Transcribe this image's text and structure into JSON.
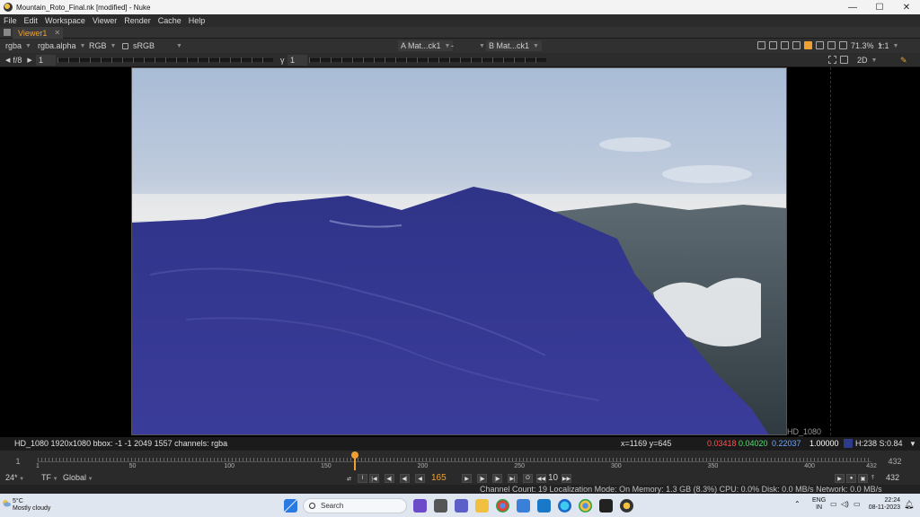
{
  "window": {
    "title": "Mountain_Roto_Final.nk [modified] - Nuke",
    "controls": [
      "—",
      "☐",
      "✕"
    ]
  },
  "menu": [
    "File",
    "Edit",
    "Workspace",
    "Viewer",
    "Render",
    "Cache",
    "Help"
  ],
  "tab": {
    "label": "Viewer1",
    "close": "✕"
  },
  "viewer_controls": {
    "channels": "rgba",
    "alpha": "rgba.alpha",
    "display": "RGB",
    "colorspace": "sRGB",
    "input_a": "A  Mat...ck1",
    "input_a_op": "-",
    "input_b": "B  Mat...ck1",
    "zoom": "71.3%",
    "proxy": "1:1",
    "fstop": "f/8",
    "gain_val": "1",
    "gamma_label": "γ",
    "gamma_val": "1",
    "view_mode": "2D"
  },
  "viewer": {
    "format_label": "HD_1080"
  },
  "info": {
    "format": "HD_1080 1920x1080  bbox: -1 -1 2049 1557 channels: rgba",
    "coords": "x=1169 y=645",
    "r": "0.03418",
    "g": "0.04020",
    "b": "0.22037",
    "a": "1.00000",
    "hsv": "H:238 S:0.84",
    "swatch_color": "#2e3b8a"
  },
  "timeline": {
    "start": "1",
    "end": "432",
    "ticks": [
      "1",
      "50",
      "100",
      "150",
      "200",
      "250",
      "300",
      "350",
      "400",
      "432"
    ],
    "current_frame_fraction": 0.38
  },
  "transport": {
    "fps": "24*",
    "tf": "TF",
    "scope": "Global",
    "current_frame": "165",
    "increment": "10",
    "end_frame": "432"
  },
  "status": {
    "text": "Channel Count: 19  Localization Mode: On  Memory: 1.3 GB (8.3%)  CPU: 0.0%  Disk: 0.0 MB/s  Network: 0.0 MB/s"
  },
  "taskbar": {
    "temp": "5°C",
    "weather": "Mostly cloudy",
    "search_placeholder": "Search",
    "lang1": "ENG",
    "lang2": "IN",
    "time": "22:24",
    "date": "08-11-2023"
  }
}
